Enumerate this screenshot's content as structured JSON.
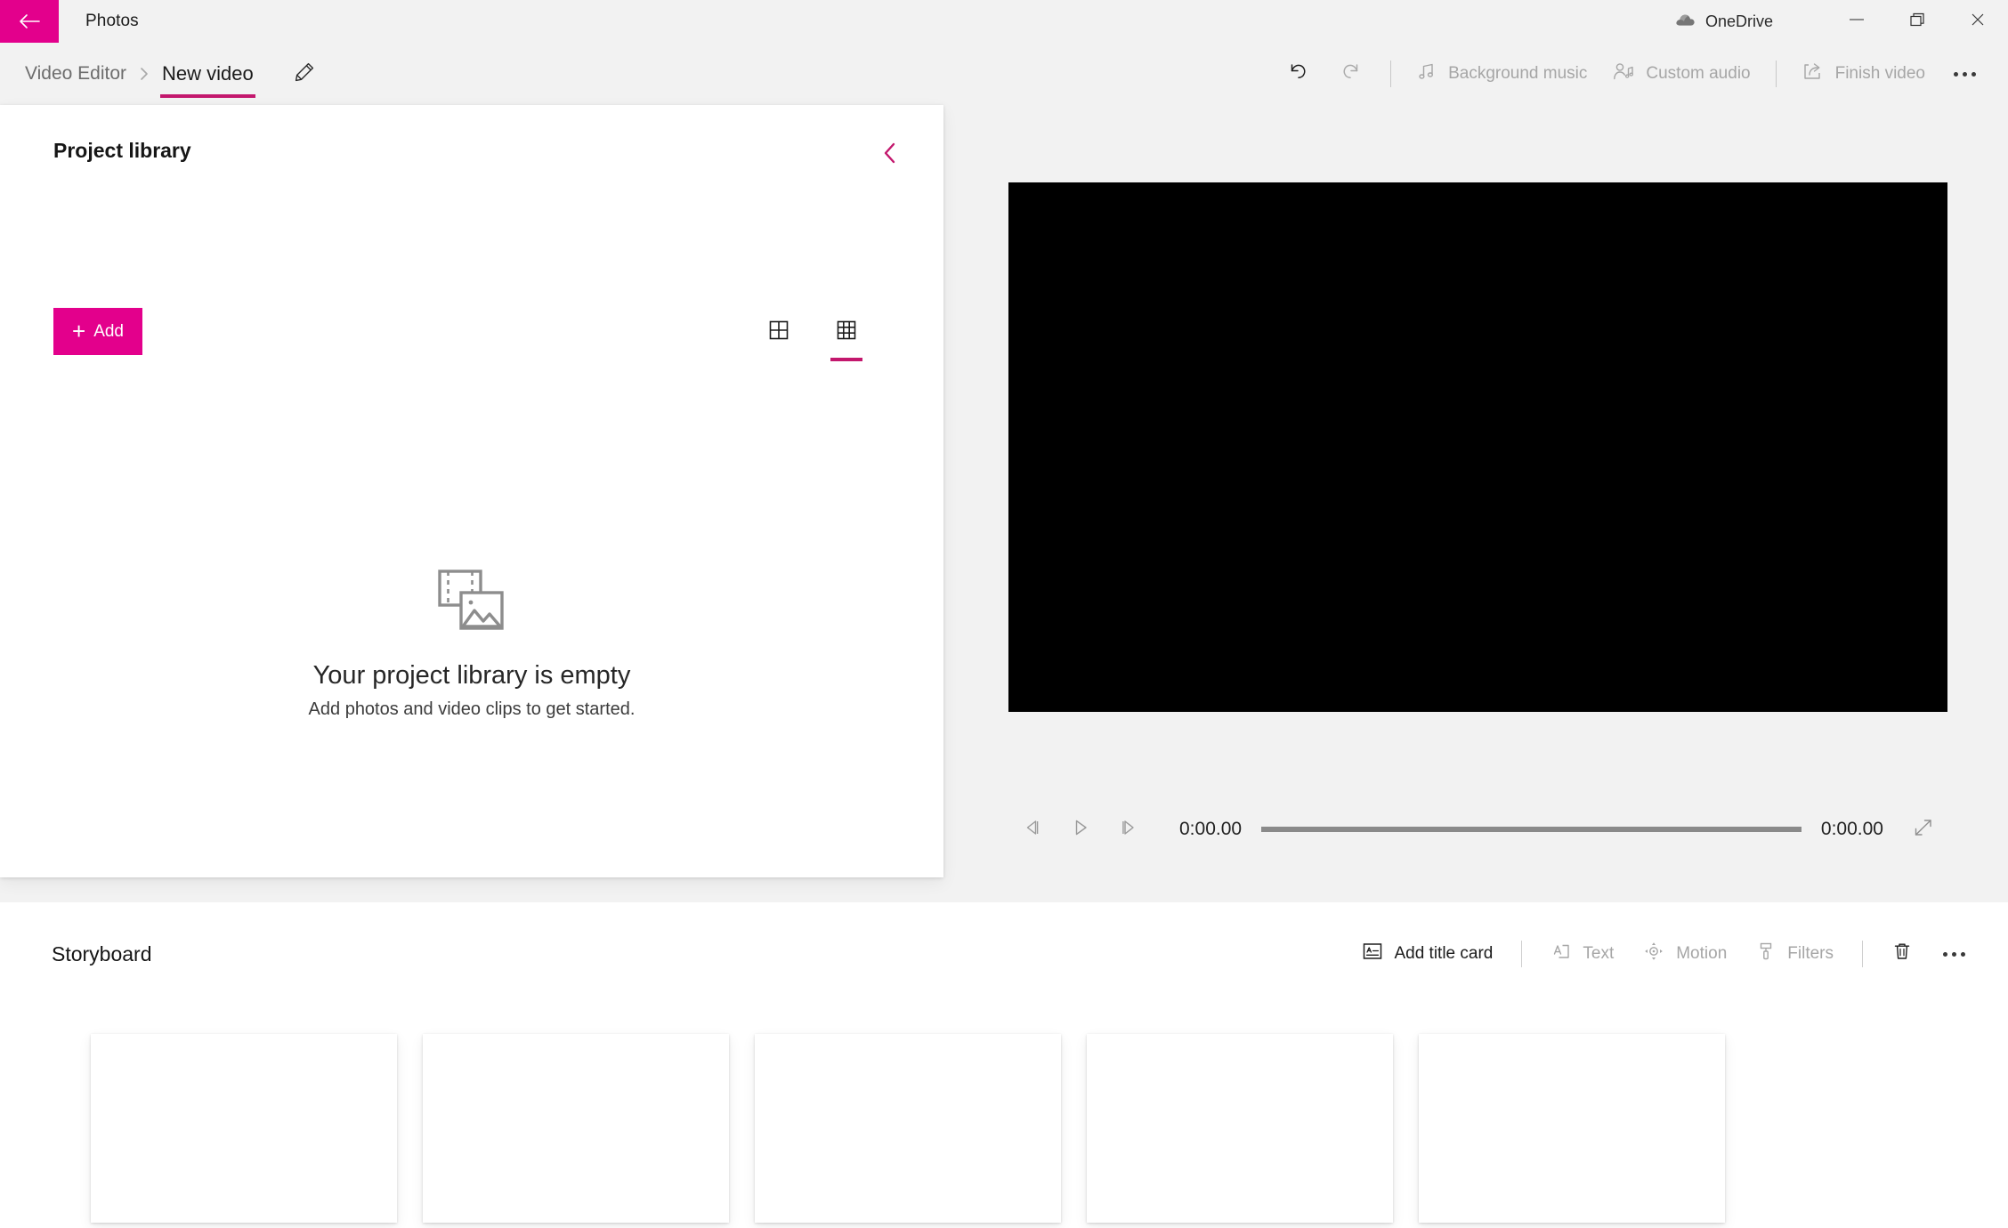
{
  "window": {
    "app_title": "Photos",
    "back_icon": "back-arrow-icon",
    "account": {
      "label": "OneDrive",
      "icon": "onedrive-cloud-icon"
    },
    "controls": {
      "minimize": "minimize-icon",
      "maximize": "restore-icon",
      "close": "close-icon"
    }
  },
  "commandbar": {
    "breadcrumb": {
      "parent": "Video Editor",
      "separator": "chevron-right-icon",
      "current": "New video",
      "rename_icon": "pencil-icon"
    },
    "actions": [
      {
        "label": "",
        "icon": "undo-icon",
        "disabled": false
      },
      {
        "label": "",
        "icon": "redo-icon",
        "disabled": true
      },
      {
        "label": "Background music",
        "icon": "music-note-icon",
        "disabled": true
      },
      {
        "label": "Custom audio",
        "icon": "person-audio-icon",
        "disabled": true
      },
      {
        "label": "Finish video",
        "icon": "share-export-icon",
        "disabled": true
      }
    ],
    "overflow": "more-options-icon"
  },
  "library": {
    "title": "Project library",
    "collapse_icon": "chevron-left-icon",
    "add_button": {
      "label": "Add",
      "plus": "+",
      "icon": "plus-icon"
    },
    "view_toggles": [
      {
        "name": "large-grid-view",
        "icon": "grid-2x2-icon",
        "selected": false
      },
      {
        "name": "small-grid-view",
        "icon": "grid-3x3-icon",
        "selected": true
      }
    ],
    "empty_state": {
      "icon": "filmstrip-photo-icon",
      "title": "Your project library is empty",
      "subtitle": "Add photos and video clips to get started."
    }
  },
  "preview": {
    "background_color": "#000000",
    "controls": {
      "previous_frame": "previous-frame-icon",
      "play": "play-icon",
      "next_frame": "next-frame-icon",
      "current_time": "0:00.00",
      "total_time": "0:00.00",
      "fullscreen": "fullscreen-icon",
      "progress_percent": 0
    }
  },
  "storyboard": {
    "title": "Storyboard",
    "toolbar": [
      {
        "label": "Add title card",
        "icon": "title-card-icon",
        "disabled": false
      },
      {
        "label": "Text",
        "icon": "text-icon",
        "disabled": true
      },
      {
        "label": "Motion",
        "icon": "motion-icon",
        "disabled": true
      },
      {
        "label": "Filters",
        "icon": "filters-icon",
        "disabled": true
      },
      {
        "label": "",
        "icon": "trash-icon",
        "disabled": false
      }
    ],
    "overflow": "more-options-icon",
    "cards": [
      {
        "name": "storyboard-card-1"
      },
      {
        "name": "storyboard-card-2"
      },
      {
        "name": "storyboard-card-3"
      },
      {
        "name": "storyboard-card-4"
      },
      {
        "name": "storyboard-card-5"
      }
    ]
  },
  "colors": {
    "accent_pink": "#e3008c",
    "accent_underline": "#c3176d",
    "app_background": "#f2f2f2",
    "panel_background": "#ffffff",
    "disabled_text": "#a6a6a6"
  }
}
